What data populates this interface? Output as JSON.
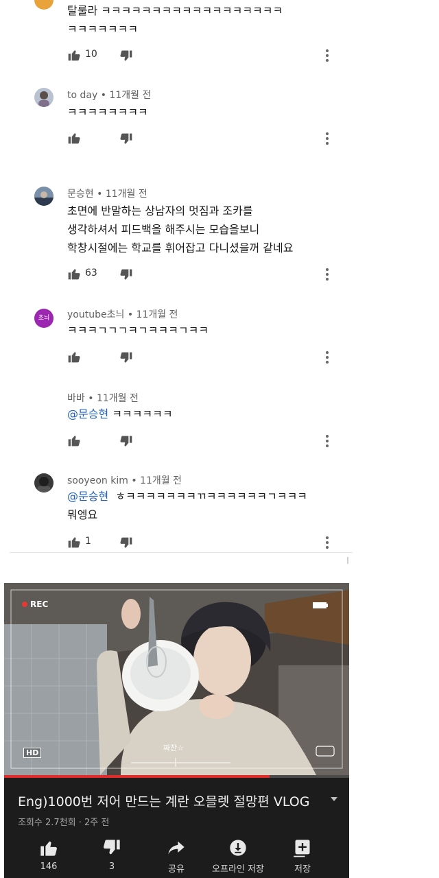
{
  "comments": [
    {
      "author": "",
      "time": "",
      "lines": [
        "탈룰라 ㅋㅋㅋㅋㅋㅋㅋㅋㅋㅋㅋㅋㅋㅋㅋㅋㅋㅋ",
        "ㅋㅋㅋㅋㅋㅋㅋ"
      ],
      "likes": "10"
    },
    {
      "author": "to day",
      "time": "11개월 전",
      "lines": [
        "ㅋㅋㅋㅋㅋㅋㅋㅋ"
      ],
      "likes": ""
    },
    {
      "author": "문승현",
      "time": "11개월 전",
      "lines": [
        "초면에 반말하는 상남자의 멋짐과 조카를",
        "생각하셔서 피드백을 해주시는 모습을보니",
        "학창시절에는 학교를 휘어잡고 다니셨을꺼 같네요"
      ],
      "likes": "63"
    },
    {
      "author": "youtube초늬",
      "avatar_text": "초늬",
      "time": "11개월 전",
      "lines": [
        "ㅋㅋㅋㄱㄱㄱㅋㄱㅋㅋㅋㄱㅋㅋ"
      ],
      "likes": ""
    },
    {
      "author": "바바",
      "time": "11개월 전",
      "mention": "@문승현",
      "lines": [
        "ㅋㅋㅋㅋㅋㅋ"
      ],
      "likes": ""
    },
    {
      "author": "sooyeon kim",
      "time": "11개월 전",
      "mention": "@문승현",
      "lines": [
        "ㅎㅋㅋㅋㅋㅋㅋㅋㄲㅋㅋㅋㅋㅋㅋㄱㅋㅋㅋ",
        "뭐엥요"
      ],
      "likes": "1"
    }
  ],
  "video": {
    "rec_label": "REC",
    "hd_label": "HD",
    "caption_tag": "짜잔☆",
    "progress": 0.77,
    "title": "Eng)1000번 저어 만드는 계란 오믈렛 절망편 VLOG",
    "meta": "조회수 2.7천회 · 2주 전",
    "actions": [
      {
        "icon": "thumb-up-icon",
        "label": "146"
      },
      {
        "icon": "thumb-down-icon",
        "label": "3"
      },
      {
        "icon": "share-icon",
        "label": "공유"
      },
      {
        "icon": "download-icon",
        "label": "오프라인 저장"
      },
      {
        "icon": "playlist-add-icon",
        "label": "저장"
      }
    ]
  },
  "colors": {
    "mention": "#1f5fbf",
    "progress_red": "#e22c2c",
    "video_bg": "#1c1c1c",
    "avatar_purple": "#9c27b0"
  }
}
